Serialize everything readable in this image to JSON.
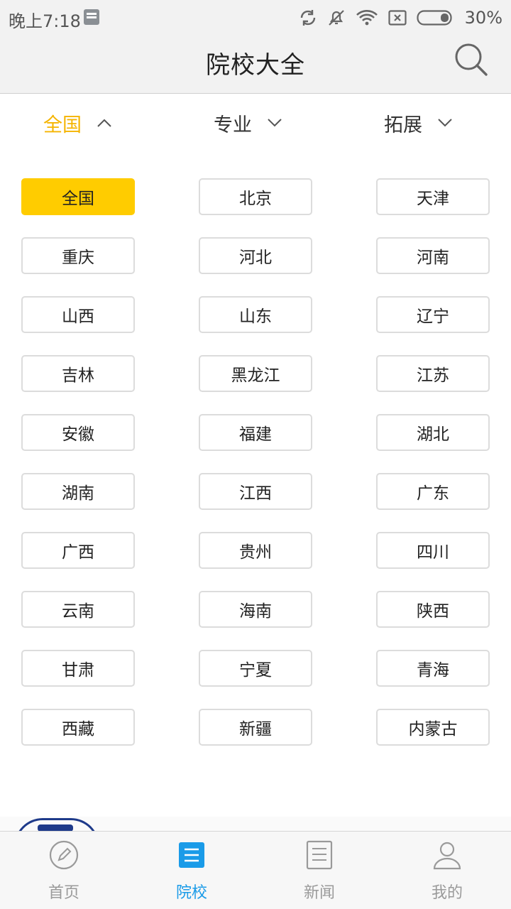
{
  "status_bar": {
    "time": "晚上7:18",
    "battery": "30%",
    "icons": [
      "notification-icon",
      "sync-icon",
      "mute-icon",
      "wifi-icon",
      "sim-icon",
      "battery-icon"
    ]
  },
  "header": {
    "title": "院校大全",
    "search_icon": "search-icon"
  },
  "filters": {
    "region": "全国",
    "major": "专业",
    "extend": "拓展"
  },
  "regions": [
    "全国",
    "北京",
    "天津",
    "重庆",
    "河北",
    "河南",
    "山西",
    "山东",
    "辽宁",
    "吉林",
    "黑龙江",
    "江苏",
    "安徽",
    "福建",
    "湖北",
    "湖南",
    "江西",
    "广东",
    "广西",
    "贵州",
    "四川",
    "云南",
    "海南",
    "陕西",
    "甘肃",
    "宁夏",
    "青海",
    "西藏",
    "新疆",
    "内蒙古"
  ],
  "selected_region": "全国",
  "bottom_nav": {
    "items": [
      {
        "label": "首页",
        "icon": "edit-circle-icon"
      },
      {
        "label": "院校",
        "icon": "list-doc-icon"
      },
      {
        "label": "新闻",
        "icon": "news-doc-icon"
      },
      {
        "label": "我的",
        "icon": "user-icon"
      }
    ],
    "active": "院校"
  },
  "colors": {
    "accent": "#ffcc00",
    "accent_text": "#f5b400",
    "nav_active": "#1a9be8",
    "header_bg": "#f2f2f2"
  }
}
